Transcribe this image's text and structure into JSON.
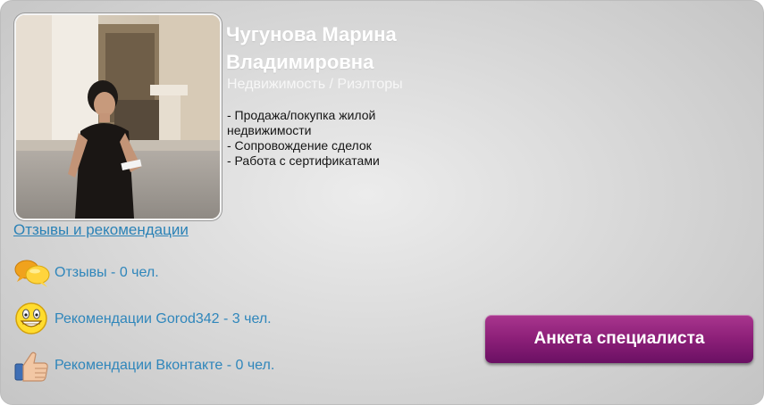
{
  "profile": {
    "name_line1": "Чугунова Марина",
    "name_line2": "Владимировна",
    "category": "Недвижимость / Риэлторы",
    "services": [
      "- Продажа/покупка жилой недвижимости",
      "- Сопровождение сделок",
      "- Работа с сертификатами"
    ]
  },
  "reviews_link": "Отзывы и рекомендации",
  "stats": [
    {
      "icon": "speech-bubbles-icon",
      "label": "Отзывы - 0 чел."
    },
    {
      "icon": "smiley-icon",
      "label": "Рекомендации Gorod342 - 3 чел."
    },
    {
      "icon": "thumbs-up-icon",
      "label": "Рекомендации Вконтакте - 0 чел."
    }
  ],
  "profile_button": "Анкета специалиста",
  "colors": {
    "link": "#2f86bb",
    "button": "#8c1f78",
    "name": "#ffffff"
  }
}
